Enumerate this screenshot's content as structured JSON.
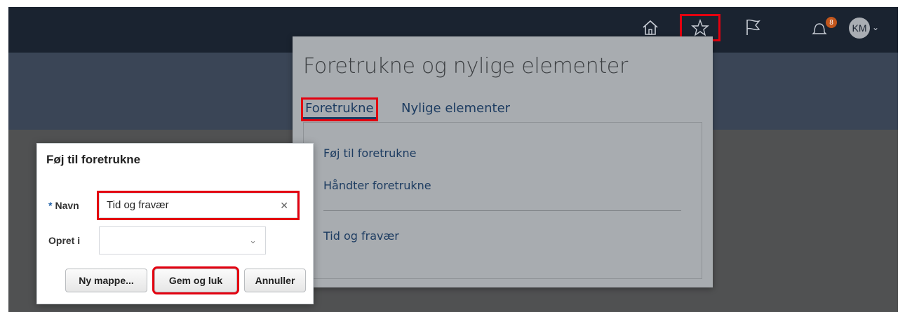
{
  "header": {
    "icons": [
      "home-icon",
      "star-icon",
      "flag-icon",
      "bell-icon"
    ],
    "notification_count": "8",
    "user_initials": "KM"
  },
  "favorites_panel": {
    "title": "Foretrukne og nylige elementer",
    "tabs": [
      {
        "label": "Foretrukne",
        "active": true
      },
      {
        "label": "Nylige elementer",
        "active": false
      }
    ],
    "actions": [
      "Føj til foretrukne",
      "Håndter foretrukne"
    ],
    "items": [
      "Tid og fravær"
    ]
  },
  "dialog": {
    "title": "Føj til foretrukne",
    "name_label": "Navn",
    "name_value": "Tid og fravær",
    "create_in_label": "Opret i",
    "create_in_value": "",
    "buttons": {
      "new_folder": "Ny mappe...",
      "save_close": "Gem og luk",
      "cancel": "Annuller"
    }
  },
  "colors": {
    "topbar": "#1a2330",
    "band": "#3a4556",
    "highlight": "#e3000f",
    "link": "#1d3c61"
  }
}
